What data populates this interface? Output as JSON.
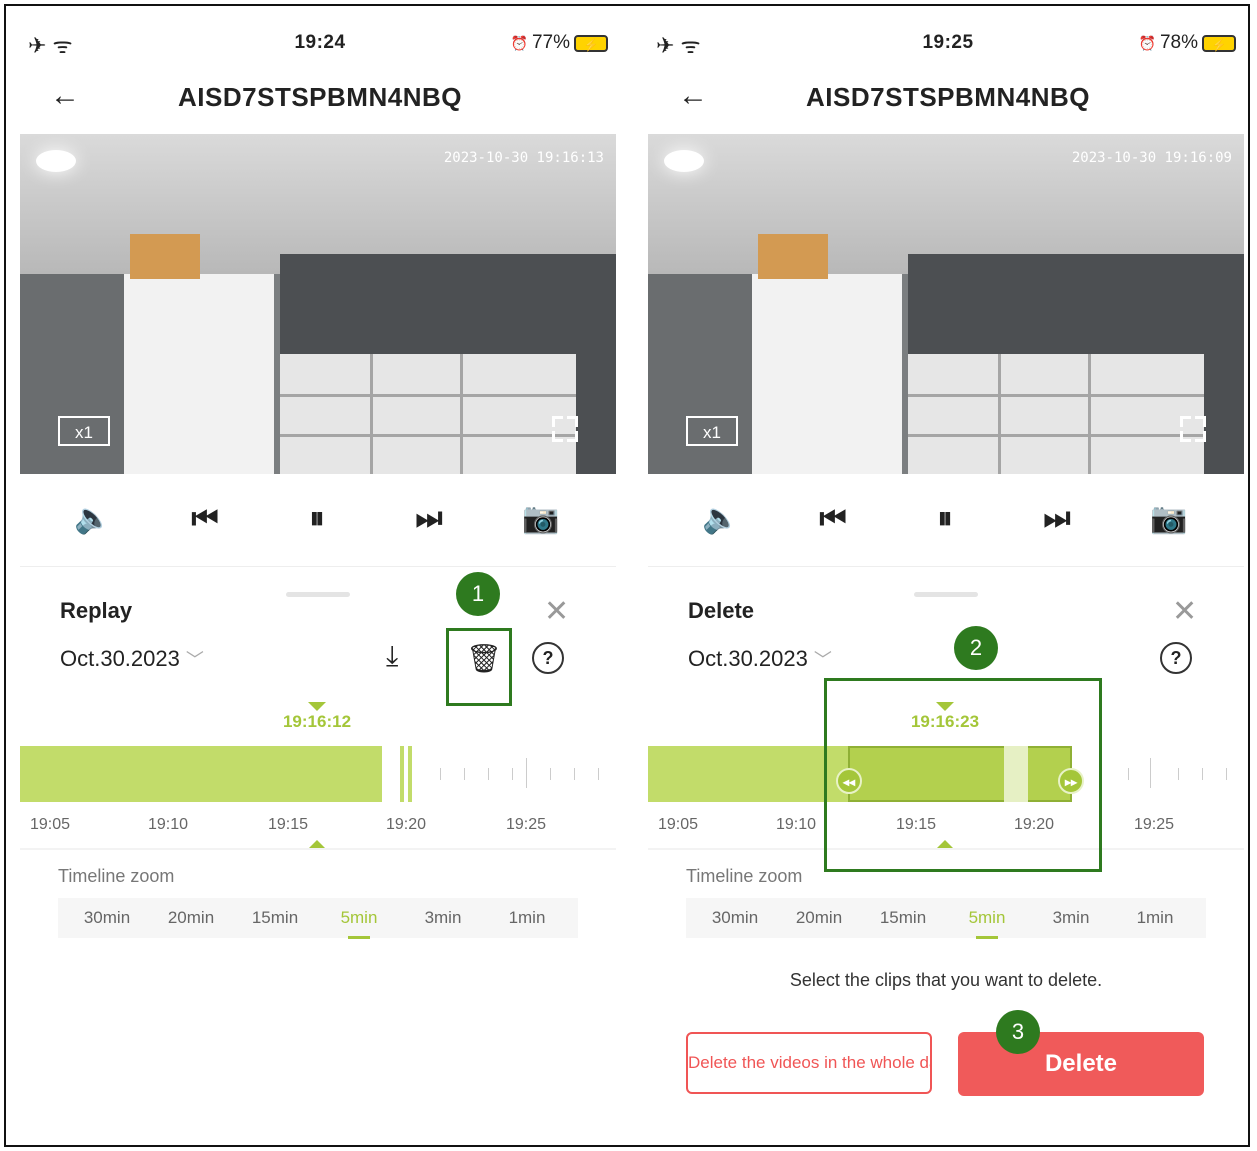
{
  "left": {
    "status": {
      "time": "19:24",
      "battery": "77%"
    },
    "title": "AISD7STSPBMN4NBQ",
    "timestamp": "2023-10-30 19:16:13",
    "zoom": "x1",
    "panel_title": "Replay",
    "date": "Oct.30.2023",
    "cursor_time": "19:16:12",
    "ticks": [
      "19:05",
      "19:10",
      "19:15",
      "19:20",
      "19:25"
    ],
    "zoom_title": "Timeline zoom",
    "zoom_options": [
      "30min",
      "20min",
      "15min",
      "5min",
      "3min",
      "1min"
    ],
    "zoom_selected": "5min",
    "badge": "1"
  },
  "right": {
    "status": {
      "time": "19:25",
      "battery": "78%"
    },
    "title": "AISD7STSPBMN4NBQ",
    "timestamp": "2023-10-30 19:16:09",
    "zoom": "x1",
    "panel_title": "Delete",
    "date": "Oct.30.2023",
    "cursor_time": "19:16:23",
    "ticks": [
      "19:05",
      "19:10",
      "19:15",
      "19:20",
      "19:25"
    ],
    "zoom_title": "Timeline zoom",
    "zoom_options": [
      "30min",
      "20min",
      "15min",
      "5min",
      "3min",
      "1min"
    ],
    "zoom_selected": "5min",
    "hint": "Select the clips that you want to delete.",
    "delete_day_label": "Delete the videos in the whole day",
    "delete_label": "Delete",
    "badge2": "2",
    "badge3": "3"
  },
  "colors": {
    "accent": "#a4c639",
    "danger": "#f05a5a",
    "annotation": "#2e7a1f"
  }
}
